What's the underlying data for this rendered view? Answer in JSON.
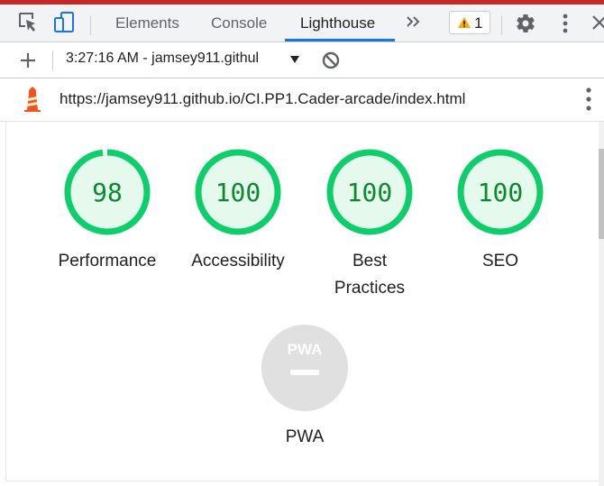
{
  "tabs": {
    "items": [
      {
        "label": "Elements"
      },
      {
        "label": "Console"
      },
      {
        "label": "Lighthouse"
      }
    ],
    "active": "Lighthouse",
    "warning_count": "1",
    "accent_color": "#1a73e8"
  },
  "toolbar": {
    "report_label": "3:27:16 AM - jamsey911.githul"
  },
  "url": {
    "text": "https://jamsey911.github.io/CI.PP1.Cader-arcade/index.html"
  },
  "categories": [
    {
      "label": "Performance",
      "score": "98",
      "fraction": 0.98
    },
    {
      "label": "Accessibility",
      "score": "100",
      "fraction": 1.0
    },
    {
      "label": "Best\nPractices",
      "score": "100",
      "fraction": 1.0
    },
    {
      "label": "SEO",
      "score": "100",
      "fraction": 1.0
    }
  ],
  "pwa": {
    "label": "PWA",
    "badge_text": "PWA"
  },
  "colors": {
    "pass": "#0cce6b",
    "pass_fill": "#e6f9ed",
    "score_text": "#0a8a2e",
    "pwa_gray": "#e0e0e0"
  }
}
